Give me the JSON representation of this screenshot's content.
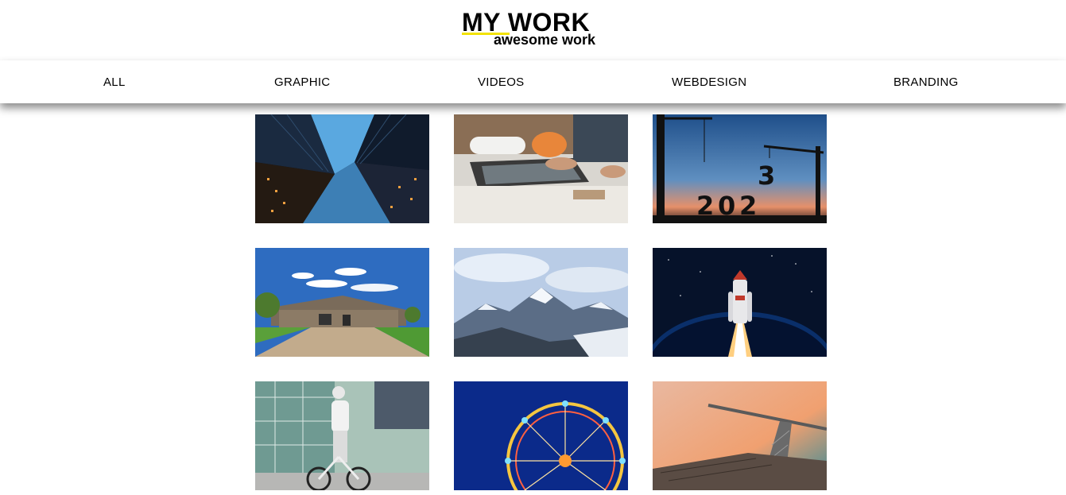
{
  "header": {
    "title": "MY WORK",
    "subtitle": "awesome work",
    "accent_color": "#f2e200"
  },
  "nav": {
    "items": [
      {
        "label": "ALL"
      },
      {
        "label": "GRAPHIC"
      },
      {
        "label": "VIDEOS"
      },
      {
        "label": "WEBDESIGN"
      },
      {
        "label": "BRANDING"
      }
    ]
  },
  "gallery": {
    "items": [
      {
        "subject": "skyscrapers-looking-up"
      },
      {
        "subject": "architect-with-laptop-and-blueprints"
      },
      {
        "subject": "cranes-lifting-2023-sunset",
        "overlay_text": [
          "2",
          "0",
          "2",
          "3"
        ]
      },
      {
        "subject": "suburban-house-blue-sky"
      },
      {
        "subject": "snowy-mountain-range"
      },
      {
        "subject": "rocket-launch-over-planet"
      },
      {
        "subject": "woman-cycling-city"
      },
      {
        "subject": "ferris-wheel-night-lights"
      },
      {
        "subject": "crane-against-pink-sky"
      }
    ]
  }
}
